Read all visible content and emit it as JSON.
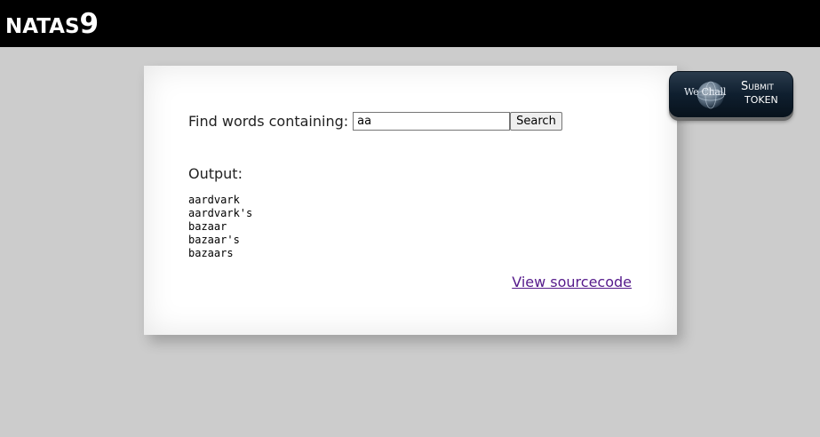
{
  "header": {
    "title_name": "NATAS",
    "title_level": "9"
  },
  "form": {
    "label": "Find words containing:",
    "input_value": "aa",
    "button_label": "Search"
  },
  "output": {
    "label": "Output:",
    "lines": [
      "aardvark",
      "aardvark's",
      "bazaar",
      "bazaar's",
      "bazaars"
    ]
  },
  "links": {
    "view_source": "View sourcecode"
  },
  "wechall": {
    "logo_text": "We Chall",
    "submit_label": "Submit",
    "token_label": "TOKEN"
  },
  "colors": {
    "background": "#cccccc",
    "header_bg": "#000000",
    "link_visited": "#551a8b"
  }
}
